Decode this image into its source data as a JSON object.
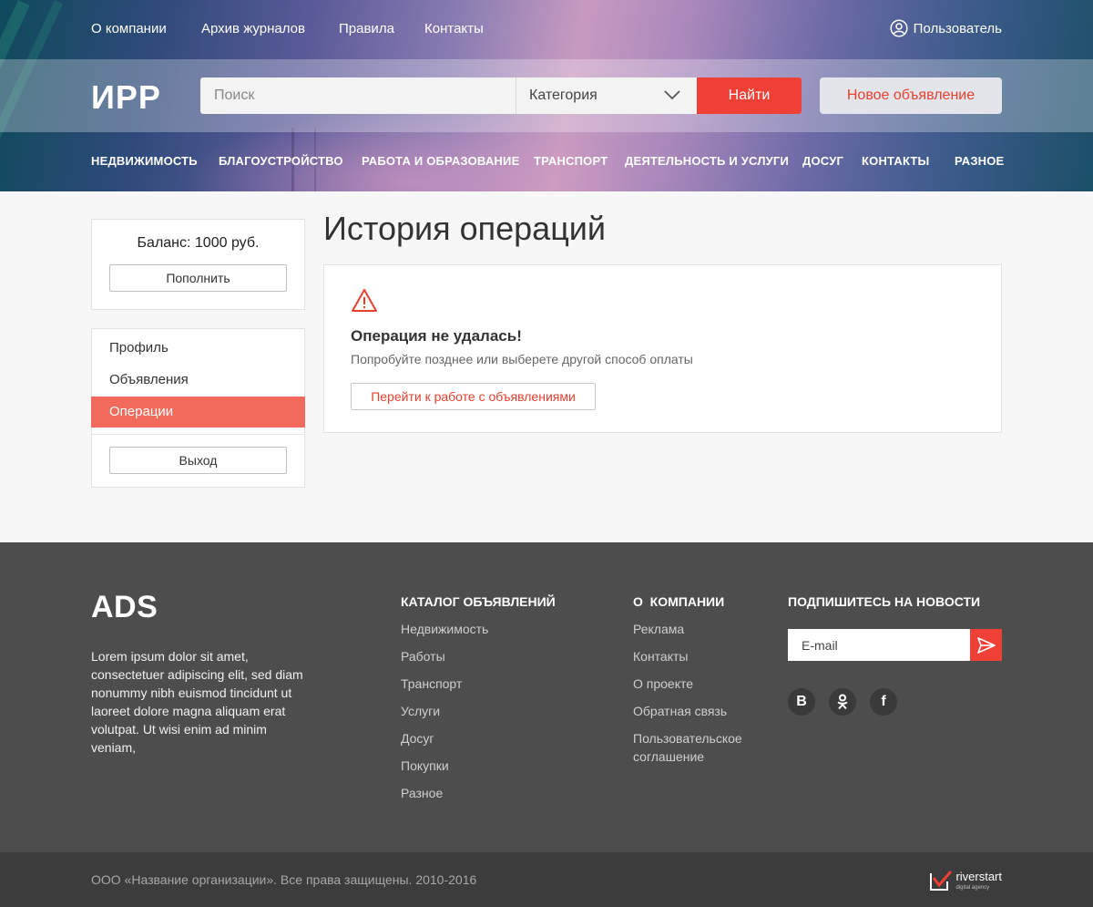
{
  "topnav": {
    "items": [
      "О компании",
      "Архив журналов",
      "Правила",
      "Контакты"
    ],
    "user_label": "Пользователь"
  },
  "header": {
    "logo": "ИРР",
    "search_placeholder": "Поиск",
    "category_label": "Категория",
    "find_label": "Найти",
    "new_ad_label": "Новое объявление"
  },
  "categories": [
    "НЕДВИЖИМОСТЬ",
    "БЛАГОУСТРОЙСТВО",
    "РАБОТА И ОБРАЗОВАНИЕ",
    "ТРАНСПОРТ",
    "ДЕЯТЕЛЬНОСТЬ И УСЛУГИ",
    "ДОСУГ",
    "КОНТАКТЫ",
    "РАЗНОЕ"
  ],
  "sidebar": {
    "balance": "Баланс: 1000 руб.",
    "topup_label": "Пополнить",
    "menu": [
      "Профиль",
      "Объявления",
      "Операции"
    ],
    "active_index": 2,
    "logout_label": "Выход"
  },
  "main": {
    "title": "История операций",
    "error_title": "Операция не удалась!",
    "error_text": "Попробуйте позднее или выберете другой способ оплаты",
    "action_label": "Перейти к работе с объявлениями"
  },
  "footer": {
    "logo": "ADS",
    "description": "Lorem ipsum dolor sit amet, consectetuer adipiscing elit, sed diam nonummy nibh euismod tincidunt ut laoreet dolore magna aliquam erat volutpat. Ut wisi enim ad minim veniam,",
    "catalog_title": "КАТАЛОГ ОБЪЯВЛЕНИЙ",
    "catalog_links": [
      "Недвижимость",
      "Работы",
      "Транспорт",
      "Услуги",
      "Досуг",
      "Покупки",
      "Разное"
    ],
    "company_title": "О  КОМПАНИИ",
    "company_links": [
      "Реклама",
      "Контакты",
      "О проекте",
      "Обратная связь",
      "Пользовательское соглашение"
    ],
    "subscribe_title": "ПОДПИШИТЕСЬ НА НОВОСТИ",
    "email_placeholder": "E-mail",
    "social": [
      "B",
      "ok",
      "f"
    ],
    "copyright": "ООО «Название организации». Все права защищены. 2010-2016",
    "agency": "riverstart",
    "agency_sub": "digital agency"
  },
  "colors": {
    "accent": "#ef4036",
    "active_menu": "#f26a5c",
    "footer_bg": "#4d4d4d"
  }
}
